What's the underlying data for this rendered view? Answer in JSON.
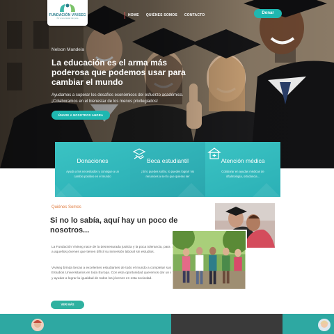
{
  "logo": {
    "name": "FUNDACIÓN VIVISEG",
    "tagline": "Por una sociedad más justa"
  },
  "nav": {
    "items": [
      {
        "label": "HOME",
        "active": true
      },
      {
        "label": "QUIÉNES SOMOS",
        "active": false
      },
      {
        "label": "CONTACTO",
        "active": false
      }
    ],
    "donate_label": "Donar"
  },
  "hero": {
    "author": "Nelson Mandela",
    "title": "La educación es el arma más poderosa que podemos usar para cambiar el mundo",
    "text": "Ayudamos a superar los desafíos económicos del esfuerzo académico. ¡Colaboramos en el bienestar de los menos privilegiados!",
    "cta_label": "ÚNASE A NOSOTROS AHORA"
  },
  "services": [
    {
      "title": "Donaciones",
      "text": "Ayuda a los necesitados y consigue a un cambio positivo en el mundo",
      "icon": "heart-hand-icon"
    },
    {
      "title": "Beca estudiantil",
      "text": "¡Si lo puedes soñar, lo puedes lograr! No renuncies a ser lo que quieras ser",
      "icon": "graduation-handshake-icon"
    },
    {
      "title": "Atención médica",
      "text": "Colaborar en ayudas médicas de oftalmología, ortodoncia...",
      "icon": "hospital-building-icon"
    }
  ],
  "about": {
    "eyebrow": "Quiénes Somos",
    "title": "Si no lo sabía, aquí hay un poco de nosotros...",
    "paragraph1": "La Fundación Viviseg nace de la desmesurada justicia y la poca tolerancia, para ayudar a aquellos jóvenes que tienen difícil su inmersión laboral sin estudios.",
    "paragraph2": "Viviseg brinda becas a excelentes estudiantes de todo el mundo a completar sus Estudios Universitarios en toda Europa. Con esta oportunidad queremos dar un impulso y ayudar a lograr la igualdad de todos los jóvenes en esta sociedad.",
    "more_label": "VER MÁS"
  },
  "colors": {
    "accent": "#1fb7b0",
    "card": "#35bcbf",
    "eyebrow": "#e07a3c",
    "band": "#2ea8a2",
    "band_dark": "#3a3a3a"
  }
}
